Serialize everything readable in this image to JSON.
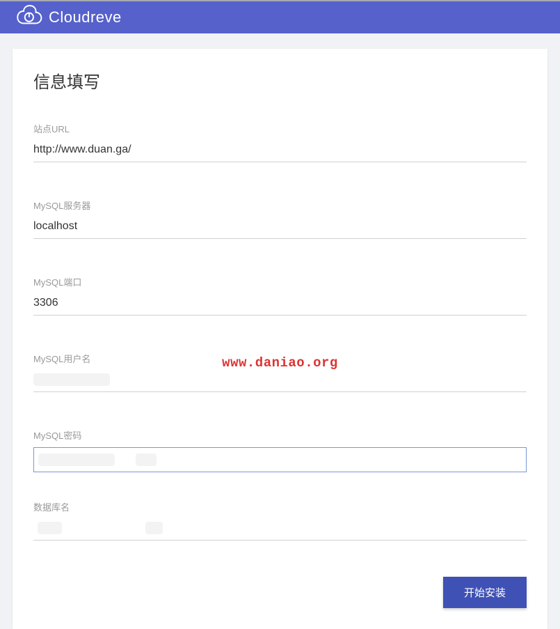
{
  "header": {
    "brand": "Cloudreve"
  },
  "page": {
    "title": "信息填写"
  },
  "form": {
    "site_url": {
      "label": "站点URL",
      "value": "http://www.duan.ga/"
    },
    "mysql_server": {
      "label": "MySQL服务器",
      "value": "localhost"
    },
    "mysql_port": {
      "label": "MySQL端口",
      "value": "3306"
    },
    "mysql_user": {
      "label": "MySQL用户名",
      "value": ""
    },
    "mysql_password": {
      "label": "MySQL密码",
      "value": ""
    },
    "database_name": {
      "label": "数据库名",
      "value": ""
    }
  },
  "actions": {
    "submit_label": "开始安装"
  },
  "watermark": "www.daniao.org"
}
